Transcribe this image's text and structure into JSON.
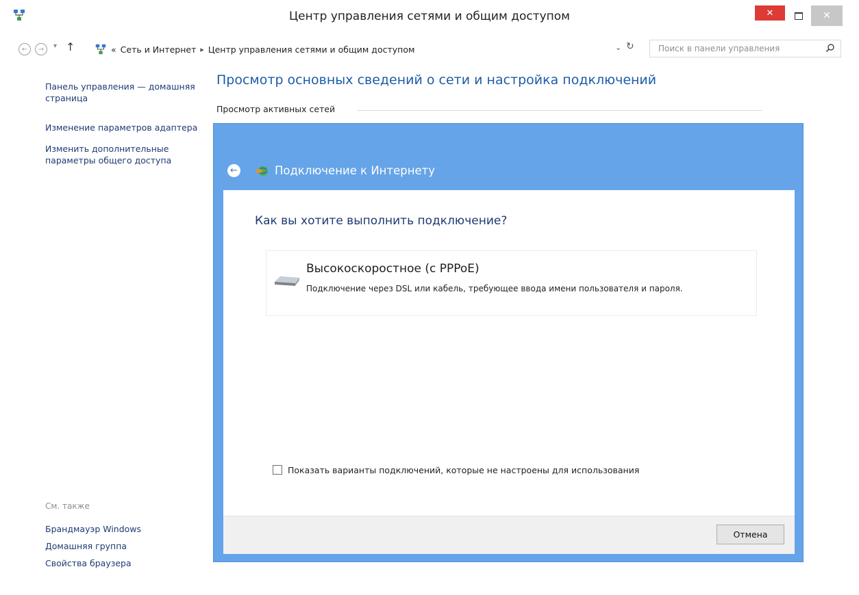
{
  "window": {
    "title": "Центр управления сетями и общим доступом",
    "close_glyph": "✕"
  },
  "address_bar": {
    "recent_glyph": "▾",
    "up_glyph": "↑",
    "prefix": "«",
    "breadcrumbs": [
      "Сеть и Интернет",
      "Центр управления сетями и общим доступом"
    ],
    "separator": "▸",
    "dropdown_glyph": "⌄",
    "refresh_glyph": "↻",
    "search_placeholder": "Поиск в панели управления"
  },
  "sidebar": {
    "items": [
      "Панель управления — домашняя страница",
      "Изменение параметров адаптера",
      "Изменить дополнительные параметры общего доступа"
    ],
    "see_also_title": "См. также",
    "see_also": [
      "Брандмауэр Windows",
      "Домашняя группа",
      "Свойства браузера"
    ]
  },
  "main": {
    "heading": "Просмотр основных сведений о сети и настройка подключений",
    "active_networks": "Просмотр активных сетей"
  },
  "dialog": {
    "title": "Подключение к Интернету",
    "back_glyph": "←",
    "close_glyph": "✕",
    "question": "Как вы хотите выполнить подключение?",
    "option": {
      "title": "Высокоскоростное (с PPPoE)",
      "description": "Подключение через DSL или кабель, требующее ввода имени пользователя и пароля."
    },
    "checkbox_label": "Показать варианты подключений, которые не настроены для использования",
    "checkbox_checked": false,
    "cancel_label": "Отмена"
  },
  "colors": {
    "dialog_frame": "#65a4e8",
    "close_red": "#dd3b36",
    "link": "#1e3a73",
    "heading": "#1d5ca8"
  },
  "icons": [
    "network-center-icon",
    "back-arrow-icon",
    "forward-arrow-icon",
    "up-arrow-icon",
    "refresh-icon",
    "search-icon",
    "internet-connection-icon",
    "broadband-modem-icon"
  ]
}
